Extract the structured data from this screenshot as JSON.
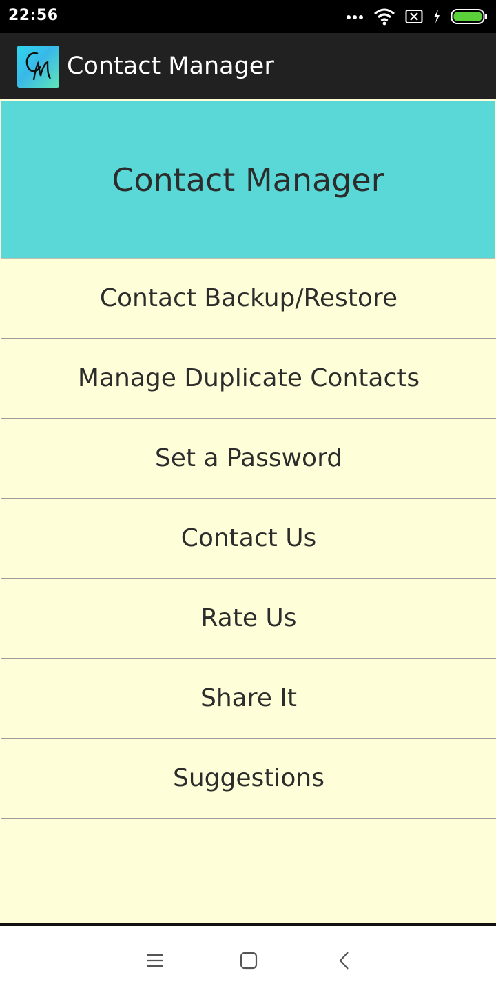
{
  "status_bar": {
    "time": "22:56",
    "icons": [
      "more-dots-icon",
      "wifi-icon",
      "sim-no-signal-icon",
      "charging-bolt-icon",
      "battery-icon"
    ]
  },
  "app_bar": {
    "logo_text": "CM",
    "title": "Contact Manager"
  },
  "banner": {
    "title": "Contact Manager",
    "color": "#5ad7d7"
  },
  "menu": {
    "items": [
      {
        "label": "Contact Backup/Restore"
      },
      {
        "label": "Manage Duplicate Contacts"
      },
      {
        "label": "Set a Password"
      },
      {
        "label": "Contact Us"
      },
      {
        "label": "Rate Us"
      },
      {
        "label": "Share It"
      },
      {
        "label": "Suggestions"
      }
    ]
  },
  "nav_bar": {
    "buttons": [
      "menu-icon",
      "home-icon",
      "back-icon"
    ]
  },
  "colors": {
    "background": "#fefed8",
    "app_bar": "#212121",
    "banner": "#5ad7d7",
    "text": "#2c2c2c",
    "divider": "#9e9e9e"
  }
}
